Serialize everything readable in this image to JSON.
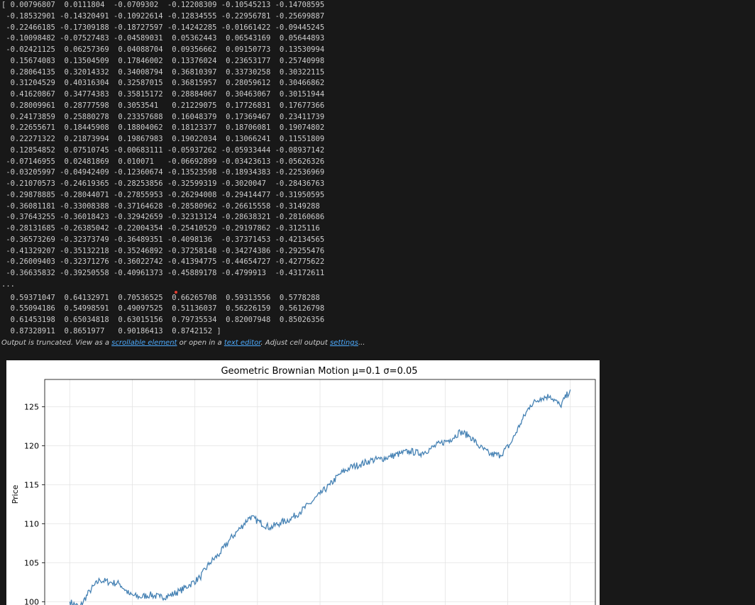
{
  "output": {
    "lines": [
      "[ 0.00796807  0.0111804  -0.0709302  -0.12208309 -0.10545213 -0.14708595",
      " -0.18532901 -0.14320491 -0.10922614 -0.12834555 -0.22956781 -0.25699887",
      " -0.22466185 -0.17309188 -0.18727597 -0.14242285 -0.01661422 -0.09445245",
      " -0.10098482 -0.07527483 -0.04589031  0.05362443  0.06543169  0.05644893",
      " -0.02421125  0.06257369  0.04088704  0.09356662  0.09150773  0.13530994",
      "  0.15674083  0.13504509  0.17846002  0.13376024  0.23653177  0.25740998",
      "  0.28064135  0.32014332  0.34008794  0.36810397  0.33730258  0.30322115",
      "  0.31204529  0.40316304  0.32587015  0.36815957  0.28059612  0.30466862",
      "  0.41620867  0.34774383  0.35815172  0.28884067  0.30463067  0.30151944",
      "  0.28009961  0.28777598  0.3053541   0.21229075  0.17726831  0.17677366",
      "  0.24173859  0.25880278  0.23357688  0.16048379  0.17369467  0.23411739",
      "  0.22655671  0.18445908  0.18804062  0.18123377  0.18706081  0.19074802",
      "  0.22271322  0.21873994  0.19867983  0.19022034  0.13066241  0.11551809",
      "  0.12854852  0.07510745 -0.00683111 -0.05937262 -0.05933444 -0.08937142",
      " -0.07146955  0.02481869  0.010071   -0.06692899 -0.03423613 -0.05626326",
      " -0.03205997 -0.04942409 -0.12360674 -0.13523598 -0.18934383 -0.22536969",
      " -0.21070573 -0.24619365 -0.28253856 -0.32599319 -0.3020047  -0.28436763",
      " -0.29878885 -0.28044071 -0.27855953 -0.26294008 -0.29414477 -0.31950595",
      " -0.36081181 -0.33008388 -0.37164628 -0.28580962 -0.26615558 -0.3149288",
      " -0.37643255 -0.36018423 -0.32942659 -0.32313124 -0.28638321 -0.28160686",
      " -0.28131685 -0.26385042 -0.22004354 -0.25410529 -0.29197862 -0.3125116",
      " -0.36573269 -0.32373749 -0.36489351 -0.4098136  -0.37371453 -0.42134565",
      " -0.41329207 -0.35132218 -0.35246892 -0.37258148 -0.34274386 -0.29255476",
      " -0.26009403 -0.32371276 -0.36022742 -0.41394775 -0.44654727 -0.42775622",
      " -0.36635832 -0.39250558 -0.40961373 -0.45889178 -0.4799913  -0.43172611"
    ],
    "ellipsis": "...",
    "tail_lines": [
      "  0.59371047  0.64132971  0.70536525  0.66265708  0.59313556  0.5778288",
      "  0.55094186  0.54998591  0.49097525  0.51136037  0.56226159  0.56126798",
      "  0.61453198  0.65034818  0.63015156  0.79735534  0.82007948  0.85026356",
      "  0.87328911  0.8651977   0.90186413  0.8742152 ]"
    ]
  },
  "truncation": {
    "prefix": "Output is truncated. View as a ",
    "scrollable_link": "scrollable element",
    "middle": " or open in a ",
    "editor_link": "text editor",
    "middle2": ". Adjust cell output ",
    "settings_link": "settings",
    "suffix": "..."
  },
  "colors": {
    "line": "#4682b4",
    "link": "#4daafc",
    "background": "#181818"
  },
  "chart_data": {
    "type": "line",
    "title": "Geometric Brownian Motion  μ=0.1  σ=0.05",
    "ylabel": "Price",
    "xlabel": "",
    "ylim": [
      98.5,
      128.5
    ],
    "yticks": [
      100,
      105,
      110,
      115,
      120,
      125
    ],
    "xlim": [
      -0.05,
      1.05
    ],
    "grid": true,
    "series": [
      {
        "x": [
          0.0,
          0.02,
          0.04,
          0.06,
          0.08,
          0.1,
          0.12,
          0.14,
          0.16,
          0.18,
          0.2,
          0.22,
          0.24,
          0.26,
          0.28,
          0.3,
          0.32,
          0.34,
          0.36,
          0.38,
          0.4,
          0.42,
          0.44,
          0.46,
          0.48,
          0.5,
          0.52,
          0.54,
          0.56,
          0.58,
          0.6,
          0.62,
          0.64,
          0.66,
          0.68,
          0.7,
          0.72,
          0.74,
          0.76,
          0.78,
          0.8,
          0.82,
          0.84,
          0.86,
          0.88,
          0.9,
          0.92,
          0.94,
          0.96,
          0.98,
          1.0
        ],
        "values": [
          100.0,
          99.3,
          101.4,
          102.8,
          102.5,
          102.3,
          100.9,
          100.6,
          100.9,
          100.6,
          100.8,
          101.4,
          102.2,
          103.1,
          105.0,
          106.2,
          108.0,
          109.4,
          110.9,
          110.2,
          109.5,
          110.1,
          110.6,
          111.5,
          112.6,
          113.8,
          115.0,
          116.4,
          117.2,
          117.6,
          118.1,
          118.3,
          118.6,
          119.0,
          119.3,
          119.0,
          119.6,
          120.3,
          120.8,
          121.8,
          121.2,
          119.8,
          118.9,
          118.8,
          120.2,
          122.8,
          125.2,
          126.1,
          126.4,
          125.1,
          127.2
        ]
      }
    ]
  }
}
